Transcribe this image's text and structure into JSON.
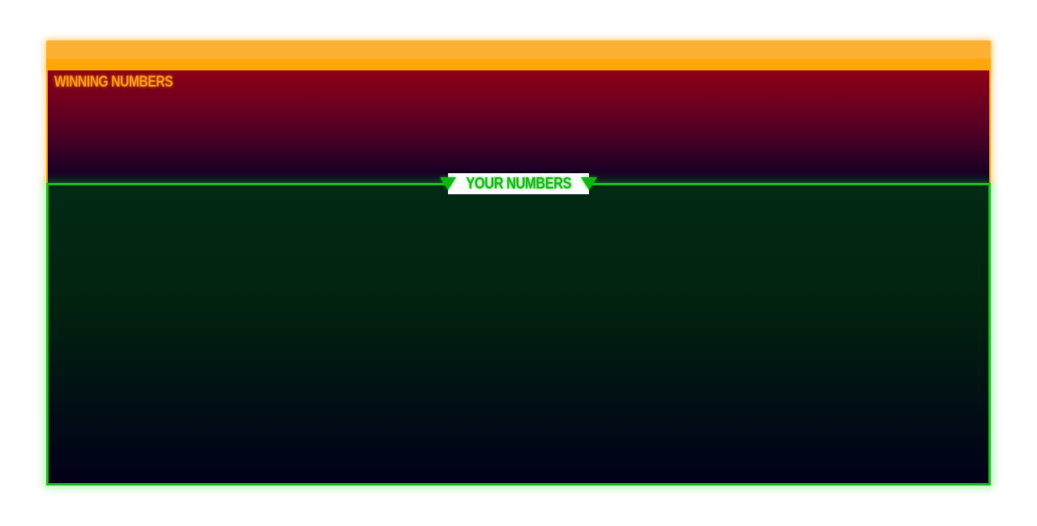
{
  "winning": {
    "title": "WINNING NUMBERS",
    "color": "#ffa60a"
  },
  "yours": {
    "title": "YOUR NUMBERS",
    "marker_icon": "triangle-down-icon",
    "color": "#13b513"
  }
}
